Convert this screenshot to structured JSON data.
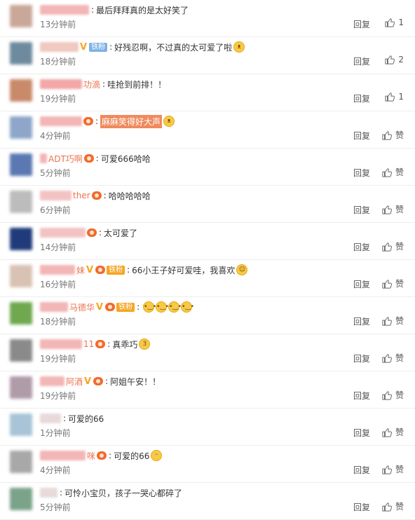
{
  "comments": [
    {
      "visible_name": "",
      "name_w": 70,
      "name_color": "#f3b6b6",
      "avatar_color": "#c9a89a",
      "crown": false,
      "badge": false,
      "fan_label": "",
      "fan_color": "",
      "text": "最后拜拜真的是太好笑了",
      "highlight": "",
      "emojis": [],
      "time": "13分钟前",
      "reply_label": "回复",
      "like_label": "1",
      "like_color": "#555"
    },
    {
      "visible_name": "",
      "name_w": 55,
      "name_color": "#f0c9c0",
      "avatar_color": "#6e8a9e",
      "crown": true,
      "badge": false,
      "fan_label": "铁粉",
      "fan_color": "#7fb2e5",
      "text": "好残忍啊，不过真的太可爱了啦",
      "highlight": "",
      "emojis": [
        "emoji-cat"
      ],
      "time": "18分钟前",
      "reply_label": "回复",
      "like_label": "2",
      "like_color": "#555"
    },
    {
      "visible_name": "功滴",
      "name_w": 60,
      "name_color": "#f3a8a8",
      "avatar_color": "#c98a6a",
      "crown": false,
      "badge": false,
      "fan_label": "",
      "fan_color": "",
      "text": "哇抢到前排！！",
      "highlight": "",
      "emojis": [],
      "time": "19分钟前",
      "reply_label": "回复",
      "like_label": "1",
      "like_color": "#555"
    },
    {
      "visible_name": "",
      "name_w": 60,
      "name_color": "#f3b6b6",
      "avatar_color": "#8da6c9",
      "crown": false,
      "badge": true,
      "fan_label": "",
      "fan_color": "",
      "text": "",
      "highlight": "麻麻笑得好大声",
      "emojis": [
        "emoji-cat"
      ],
      "time": "4分钟前",
      "reply_label": "回复",
      "like_label": "赞",
      "like_color": "#555"
    },
    {
      "visible_name": "ADT巧啊",
      "name_w": 10,
      "name_color": "#f3b6b6",
      "avatar_color": "#5b78b3",
      "crown": false,
      "badge": true,
      "fan_label": "",
      "fan_color": "",
      "text": "可爱666哈哈",
      "highlight": "",
      "emojis": [],
      "time": "5分钟前",
      "reply_label": "回复",
      "like_label": "赞",
      "like_color": "#555"
    },
    {
      "visible_name": "ther",
      "name_w": 45,
      "name_color": "#f3c3c3",
      "avatar_color": "#bcbcbc",
      "crown": false,
      "badge": true,
      "fan_label": "",
      "fan_color": "",
      "text": "哈哈哈哈哈",
      "highlight": "",
      "emojis": [],
      "time": "6分钟前",
      "reply_label": "回复",
      "like_label": "赞",
      "like_color": "#555"
    },
    {
      "visible_name": "",
      "name_w": 65,
      "name_color": "#f3c3c3",
      "avatar_color": "#1f3b7a",
      "crown": false,
      "badge": true,
      "fan_label": "",
      "fan_color": "",
      "text": "太可爱了",
      "highlight": "",
      "emojis": [],
      "time": "14分钟前",
      "reply_label": "回复",
      "like_label": "赞",
      "like_color": "#555"
    },
    {
      "visible_name": "妹",
      "name_w": 50,
      "name_color": "#f3b6b6",
      "avatar_color": "#d9c2b4",
      "crown": true,
      "badge": true,
      "fan_label": "铁粉",
      "fan_color": "#f5a623",
      "text": "66小王子好可爱哇，我喜欢",
      "highlight": "",
      "emojis": [
        "emoji-smile"
      ],
      "time": "16分钟前",
      "reply_label": "回复",
      "like_label": "赞",
      "like_color": "#555"
    },
    {
      "visible_name": "马德华",
      "name_w": 40,
      "name_color": "#f3b6b6",
      "avatar_color": "#6fa84f",
      "crown": true,
      "badge": true,
      "fan_label": "铁粉",
      "fan_color": "#f5a623",
      "text": "",
      "highlight": "",
      "emojis": [
        "emoji-face",
        "emoji-face",
        "emoji-face",
        "emoji-face"
      ],
      "time": "18分钟前",
      "reply_label": "回复",
      "like_label": "赞",
      "like_color": "#555"
    },
    {
      "visible_name": "11",
      "name_w": 60,
      "name_color": "#f3b6b6",
      "avatar_color": "#8a8a8a",
      "crown": false,
      "badge": true,
      "fan_label": "",
      "fan_color": "",
      "text": "真乖巧",
      "highlight": "",
      "emojis": [
        "emoji-kiss"
      ],
      "time": "19分钟前",
      "reply_label": "回复",
      "like_label": "赞",
      "like_color": "#555"
    },
    {
      "visible_name": "阿酒",
      "name_w": 35,
      "name_color": "#f3b6b6",
      "avatar_color": "#b09ba8",
      "crown": true,
      "badge": true,
      "fan_label": "",
      "fan_color": "",
      "text": "阿姐午安！！",
      "highlight": "",
      "emojis": [],
      "time": "19分钟前",
      "reply_label": "回复",
      "like_label": "赞",
      "like_color": "#555"
    },
    {
      "visible_name": "",
      "name_w": 30,
      "name_color": "#e8dada",
      "avatar_color": "#a8c4d6",
      "crown": false,
      "badge": false,
      "fan_label": "",
      "fan_color": "",
      "text": "可爱的66",
      "highlight": "",
      "emojis": [],
      "time": "1分钟前",
      "reply_label": "回复",
      "like_label": "赞",
      "like_color": "#555"
    },
    {
      "visible_name": "咪",
      "name_w": 65,
      "name_color": "#f3b6b6",
      "avatar_color": "#a8a8a8",
      "crown": false,
      "badge": true,
      "fan_label": "",
      "fan_color": "",
      "text": "可爱的66",
      "highlight": "",
      "emojis": [
        "emoji-grin"
      ],
      "time": "4分钟前",
      "reply_label": "回复",
      "like_label": "赞",
      "like_color": "#555"
    },
    {
      "visible_name": "",
      "name_w": 25,
      "name_color": "#e8dada",
      "avatar_color": "#7aa38a",
      "crown": false,
      "badge": false,
      "fan_label": "",
      "fan_color": "",
      "text": "可怜小宝贝，孩子一哭心都碎了",
      "highlight": "",
      "emojis": [],
      "time": "5分钟前",
      "reply_label": "回复",
      "like_label": "赞",
      "like_color": "#555"
    }
  ]
}
